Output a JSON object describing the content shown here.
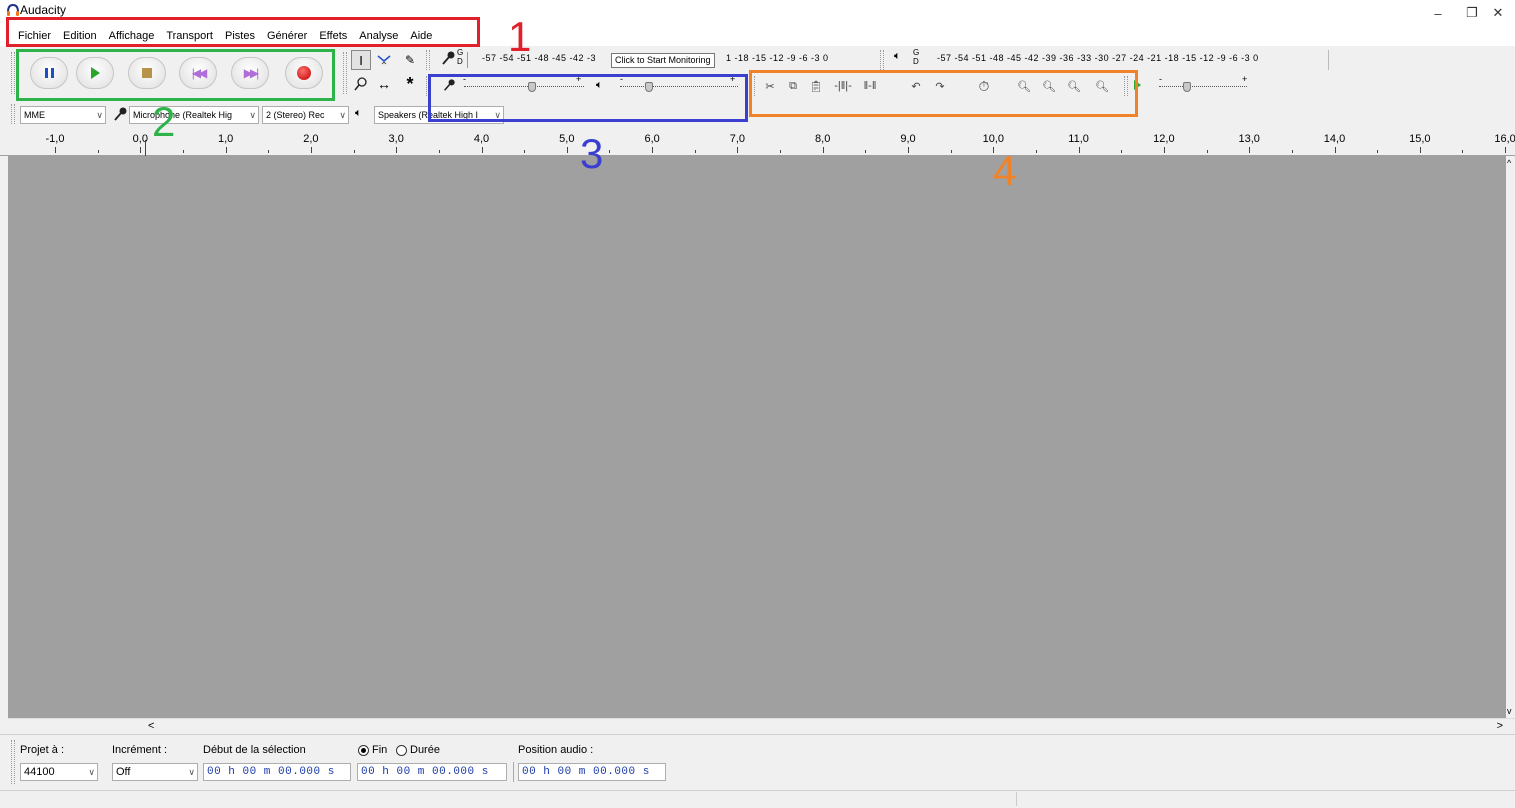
{
  "window": {
    "title": "Audacity",
    "controls": {
      "minimize": "–",
      "restore": "❐",
      "close": "✕"
    }
  },
  "menu": [
    "Fichier",
    "Edition",
    "Affichage",
    "Transport",
    "Pistes",
    "Générer",
    "Effets",
    "Analyse",
    "Aide"
  ],
  "transport": {
    "buttons": [
      "pause",
      "play",
      "stop",
      "skip-to-start",
      "skip-to-end",
      "record"
    ]
  },
  "tools": [
    "selection-tool",
    "envelope-tool",
    "draw-tool",
    "zoom-tool",
    "timeshift-tool",
    "multi-tool"
  ],
  "meters": {
    "record_scale": "-57 -54 -51 -48 -45 -42 -3",
    "record_tooltip": "Click to Start Monitoring",
    "record_scale_tail": "1 -18 -15 -12  -9  -6  -3  0",
    "record_channel_top": "G",
    "record_channel_bottom": "D",
    "play_channel_top": "G",
    "play_channel_bottom": "D",
    "play_scale": "-57 -54 -51 -48 -45 -42 -39 -36 -33 -30 -27 -24 -21 -18 -15 -12  -9  -6  -3  0"
  },
  "mixer": {
    "record_minus": "-",
    "record_plus": "+",
    "play_minus": "-",
    "play_plus": "+"
  },
  "play_at_speed": {
    "minus": "-",
    "plus": "+"
  },
  "devices": {
    "host": "MME",
    "recording_device": "Microphone (Realtek Hig",
    "channels": "2 (Stereo) Rec",
    "playback_device": "Speakers (Realtek High I"
  },
  "ruler": {
    "labels": [
      "-1,0",
      "0,0",
      "1,0",
      "2,0",
      "3,0",
      "4,0",
      "5,0",
      "6,0",
      "7,0",
      "8,0",
      "9,0",
      "10,0",
      "11,0",
      "12,0",
      "13,0",
      "14,0",
      "15,0",
      "16,0"
    ]
  },
  "selection_toolbar": {
    "project_rate_label": "Projet à :",
    "project_rate_value": "44100",
    "snap_label": "Incrément :",
    "snap_value": "Off",
    "start_label": "Début de la sélection",
    "end_label": "Fin",
    "duration_label": "Durée",
    "end_selected": true,
    "start_time": "00 h 00 m 00.000 s",
    "end_time": "00 h 00 m 00.000 s",
    "audio_position_label": "Position audio :",
    "audio_position": "00 h 00 m 00.000 s"
  },
  "annotations": [
    {
      "number": "1",
      "color": "#e0202a"
    },
    {
      "number": "2",
      "color": "#2db34a"
    },
    {
      "number": "3",
      "color": "#3a3fd0"
    },
    {
      "number": "4",
      "color": "#f0822a"
    }
  ],
  "colors": {
    "track_background": "#a0a0a0",
    "time_text": "#1a3aa8"
  }
}
